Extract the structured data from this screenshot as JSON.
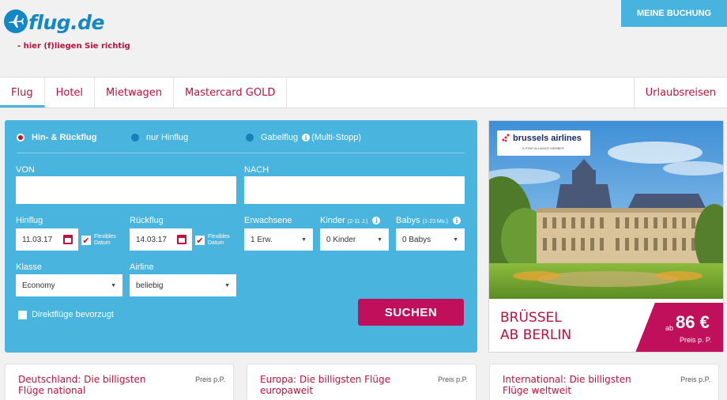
{
  "header": {
    "logo_text": "flug.de",
    "tagline": "- hier (f)liegen Sie richtig",
    "booking_button": "MEINE BUCHUNG"
  },
  "nav": {
    "tabs": [
      {
        "label": "Flug"
      },
      {
        "label": "Hotel"
      },
      {
        "label": "Mietwagen"
      },
      {
        "label": "Mastercard GOLD"
      }
    ],
    "right_tab": "Urlaubsreisen"
  },
  "search": {
    "trip_types": {
      "roundtrip": "Hin- & Rückflug",
      "oneway": "nur Hinflug",
      "multistop": "Gabelflug",
      "multistop_note": "(Multi-Stopp)"
    },
    "from_label": "VON",
    "to_label": "NACH",
    "outbound_label": "Hinflug",
    "outbound_value": "11.03.17",
    "return_label": "Rückflug",
    "return_value": "14.03.17",
    "flexible_line1": "Flexibles",
    "flexible_line2": "Datum",
    "adults_label": "Erwachsene",
    "adults_value": "1 Erw.",
    "children_label": "Kinder",
    "children_hint": "(2-11 J.)",
    "children_value": "0 Kinder",
    "babies_label": "Babys",
    "babies_hint": "(1-23 Mo.)",
    "babies_value": "0 Babys",
    "class_label": "Klasse",
    "class_value": "Economy",
    "airline_label": "Airline",
    "airline_value": "beliebig",
    "direct_label": "Direktflüge bevorzugt",
    "submit_label": "SUCHEN"
  },
  "ad": {
    "brand": "brussels airlines",
    "brand_sub": "A STAR ALLIANCE MEMBER",
    "city_line1": "BRÜSSEL",
    "city_line2": "AB BERLIN",
    "price_prefix": "ab",
    "price": "86 €",
    "price_suffix": "Preis p. P."
  },
  "cards": [
    {
      "title": "Deutschland: Die billigsten Flüge national",
      "price_label": "Preis p.P."
    },
    {
      "title": "Europa: Die billigsten Flüge europaweit",
      "price_label": "Preis p.P."
    },
    {
      "title": "International: Die billigsten Flüge weltweit",
      "price_label": "Preis p.P."
    }
  ]
}
